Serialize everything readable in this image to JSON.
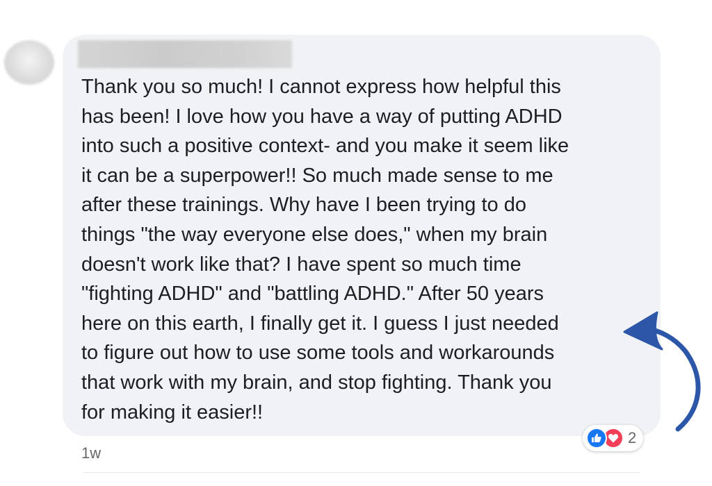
{
  "comment": {
    "lines": [
      "Thank you so much! I cannot express how helpful this",
      "has been! I love how you have a way of putting ADHD",
      "into such a positive context- and you make it seem like",
      "it can be a superpower!! So much made sense to me",
      "after these trainings. Why have I been trying to do",
      "things \"the way everyone else does,\" when my brain",
      "doesn't work like that? I have spent so much time",
      "\"fighting ADHD\" and \"battling ADHD.\" After 50 years",
      "here on this earth, I finally get it. I guess I just needed",
      "to figure out how to use some tools and workarounds",
      "that work with my brain, and stop fighting. Thank you",
      "for making it easier!!"
    ],
    "timestamp": "1w"
  },
  "reactions": {
    "icons": [
      "like-icon",
      "love-icon"
    ],
    "count": "2"
  },
  "colors": {
    "bubble": "#f0f2f5",
    "text": "#1c1e21",
    "meta": "#65676b",
    "like": "#1877f2",
    "love": "#f33e58",
    "arrow": "#2c57a8"
  }
}
